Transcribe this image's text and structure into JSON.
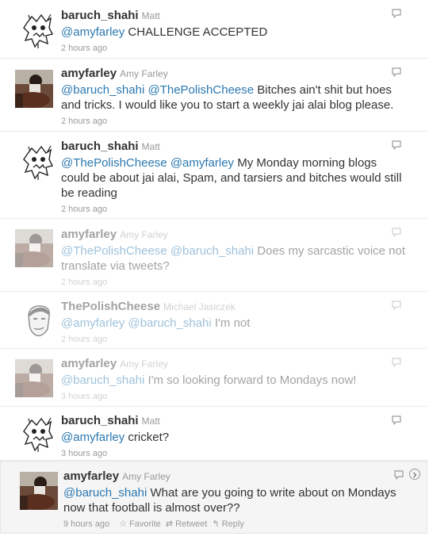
{
  "tweets": [
    {
      "user": "baruch_shahi",
      "realname": "Matt",
      "parts": [
        {
          "t": "@amyfarley",
          "link": true
        },
        {
          "t": " CHALLENGE ACCEPTED",
          "link": false
        }
      ],
      "time": "2 hours ago",
      "avatar": "skull"
    },
    {
      "user": "amyfarley",
      "realname": "Amy Farley",
      "parts": [
        {
          "t": "@baruch_shahi",
          "link": true
        },
        {
          "t": " ",
          "link": false
        },
        {
          "t": "@ThePolishCheese",
          "link": true
        },
        {
          "t": " Bitches ain't shit but hoes and tricks. I would like you to start a weekly jai alai blog please.",
          "link": false
        }
      ],
      "time": "2 hours ago",
      "avatar": "photo"
    },
    {
      "user": "baruch_shahi",
      "realname": "Matt",
      "parts": [
        {
          "t": "@ThePolishCheese",
          "link": true
        },
        {
          "t": " ",
          "link": false
        },
        {
          "t": "@amyfarley",
          "link": true
        },
        {
          "t": " My Monday morning blogs could be about jai alai, Spam, and tarsiers and bitches would still be reading",
          "link": false
        }
      ],
      "time": "2 hours ago",
      "avatar": "skull"
    },
    {
      "user": "amyfarley",
      "realname": "Amy Farley",
      "parts": [
        {
          "t": "@ThePolishCheese",
          "link": true
        },
        {
          "t": " ",
          "link": false
        },
        {
          "t": "@baruch_shahi",
          "link": true
        },
        {
          "t": " Does my sarcastic voice not translate via tweets?",
          "link": false
        }
      ],
      "time": "2 hours ago",
      "avatar": "photo"
    },
    {
      "user": "ThePolishCheese",
      "realname": "Michael Jasiczek",
      "parts": [
        {
          "t": "@amyfarley",
          "link": true
        },
        {
          "t": " ",
          "link": false
        },
        {
          "t": "@baruch_shahi",
          "link": true
        },
        {
          "t": " I'm not",
          "link": false
        }
      ],
      "time": "2 hours ago",
      "avatar": "face"
    },
    {
      "user": "amyfarley",
      "realname": "Amy Farley",
      "parts": [
        {
          "t": "@baruch_shahi",
          "link": true
        },
        {
          "t": " I'm so looking forward to Mondays now!",
          "link": false
        }
      ],
      "time": "3 hours ago",
      "avatar": "photo"
    },
    {
      "user": "baruch_shahi",
      "realname": "Matt",
      "parts": [
        {
          "t": "@amyfarley",
          "link": true
        },
        {
          "t": " cricket?",
          "link": false
        }
      ],
      "time": "3 hours ago",
      "avatar": "skull"
    },
    {
      "user": "amyfarley",
      "realname": "Amy Farley",
      "parts": [
        {
          "t": "@baruch_shahi",
          "link": true
        },
        {
          "t": " What are you going to write about on Mondays now that football is almost over??",
          "link": false
        }
      ],
      "time": "9 hours ago",
      "avatar": "photo"
    }
  ],
  "actions": {
    "favorite": "Favorite",
    "retweet": "Retweet",
    "reply": "Reply"
  },
  "colors": {
    "link": "#2b78b0",
    "username": "#333333",
    "meta": "#999999",
    "hover_bg": "#f5f5f5"
  },
  "icons": {
    "reply": "speech-bubble-icon",
    "favorite": "star-icon",
    "retweet": "retweet-icon",
    "reply_action": "reply-arrow-icon",
    "more": "chevron-right-circle-icon"
  }
}
